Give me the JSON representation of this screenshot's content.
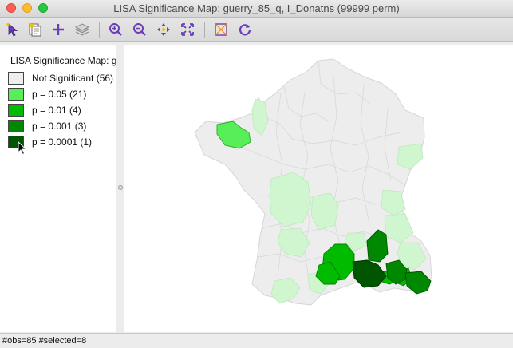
{
  "window": {
    "title": "LISA Significance Map: guerry_85_q, I_Donatns (99999 perm)"
  },
  "toolbar": {
    "buttons": [
      {
        "icon": "select-arrow-icon"
      },
      {
        "icon": "copy-selection-icon"
      },
      {
        "icon": "add-icon"
      },
      {
        "icon": "layers-icon"
      },
      {
        "icon": "zoom-in-icon"
      },
      {
        "icon": "zoom-out-icon"
      },
      {
        "icon": "pan-icon"
      },
      {
        "icon": "full-extent-icon"
      },
      {
        "icon": "background-color-icon"
      },
      {
        "icon": "refresh-icon"
      }
    ]
  },
  "legend": {
    "title": "LISA Significance Map: g",
    "items": [
      {
        "label": "Not Significant (56)",
        "color": "#eeeeee"
      },
      {
        "label": "p = 0.05 (21)",
        "color": "#58ee58"
      },
      {
        "label": "p = 0.01 (4)",
        "color": "#00bb00"
      },
      {
        "label": "p = 0.001 (3)",
        "color": "#008800"
      },
      {
        "label": "p = 0.0001 (1)",
        "color": "#005500"
      }
    ]
  },
  "map": {
    "colors": {
      "not_significant": "#ededed",
      "faded_selected": "#cff6cf",
      "p05": "#58ee58",
      "p01": "#00bb00",
      "p001": "#008800",
      "p0001": "#005500",
      "border": "#d8d8d8"
    }
  },
  "status": {
    "text": "#obs=85 #selected=8"
  }
}
